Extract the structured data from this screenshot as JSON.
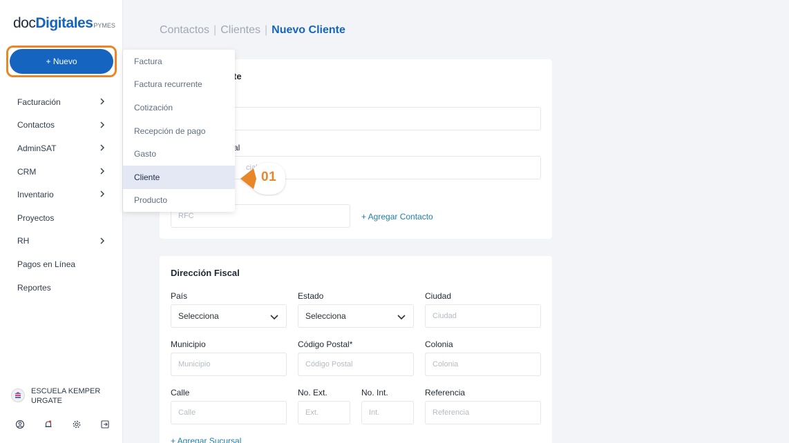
{
  "sidebar": {
    "logo": {
      "doc": "doc",
      "digitales": "Digitales",
      "pymes": "PYMES"
    },
    "new_button": "+ Nuevo",
    "items": [
      {
        "label": "Facturación",
        "has_chevron": true
      },
      {
        "label": "Contactos",
        "has_chevron": true
      },
      {
        "label": "AdminSAT",
        "has_chevron": true
      },
      {
        "label": "CRM",
        "has_chevron": true
      },
      {
        "label": "Inventario",
        "has_chevron": true
      },
      {
        "label": "Proyectos",
        "has_chevron": false
      },
      {
        "label": "RH",
        "has_chevron": true
      },
      {
        "label": "Pagos en Línea",
        "has_chevron": false
      },
      {
        "label": "Reportes",
        "has_chevron": false
      }
    ],
    "user_name": "ESCUELA KEMPER URGATE",
    "bottom_icons": [
      "user-circle-icon",
      "bell-icon",
      "gear-icon",
      "logout-icon"
    ]
  },
  "breadcrumb": {
    "items": [
      "Contactos",
      "Clientes"
    ],
    "current": "Nuevo Cliente",
    "separator": "|"
  },
  "card1": {
    "title_fragment": "te",
    "label_fragment": "al",
    "name_field_value": "",
    "commercial_placeholder_fragment": "cial",
    "rfc_placeholder": "RFC",
    "add_contact": "+ Agregar Contacto"
  },
  "card2": {
    "title": "Dirección Fiscal",
    "pais_label": "País",
    "pais_value": "Selecciona",
    "estado_label": "Estado",
    "estado_value": "Selecciona",
    "ciudad_label": "Ciudad",
    "ciudad_placeholder": "Ciudad",
    "municipio_label": "Municipio",
    "municipio_placeholder": "Municipio",
    "cp_label": "Código Postal*",
    "cp_placeholder": "Código Postal",
    "colonia_label": "Colonia",
    "colonia_placeholder": "Colonia",
    "calle_label": "Calle",
    "calle_placeholder": "Calle",
    "noext_label": "No. Ext.",
    "noext_placeholder": "Ext.",
    "noint_label": "No. Int.",
    "noint_placeholder": "Int.",
    "referencia_label": "Referencia",
    "referencia_placeholder": "Referencia",
    "add_branch": "+ Agregar Sucursal"
  },
  "dropdown": {
    "items": [
      "Factura",
      "Factura recurrente",
      "Cotización",
      "Recepción de pago",
      "Gasto",
      "Cliente",
      "Producto"
    ],
    "active_index": 5
  },
  "callout": {
    "text": "01",
    "color": "#e8862a"
  },
  "colors": {
    "primary": "#1565c0",
    "highlight": "#e8862a",
    "link": "#1d7fae"
  }
}
